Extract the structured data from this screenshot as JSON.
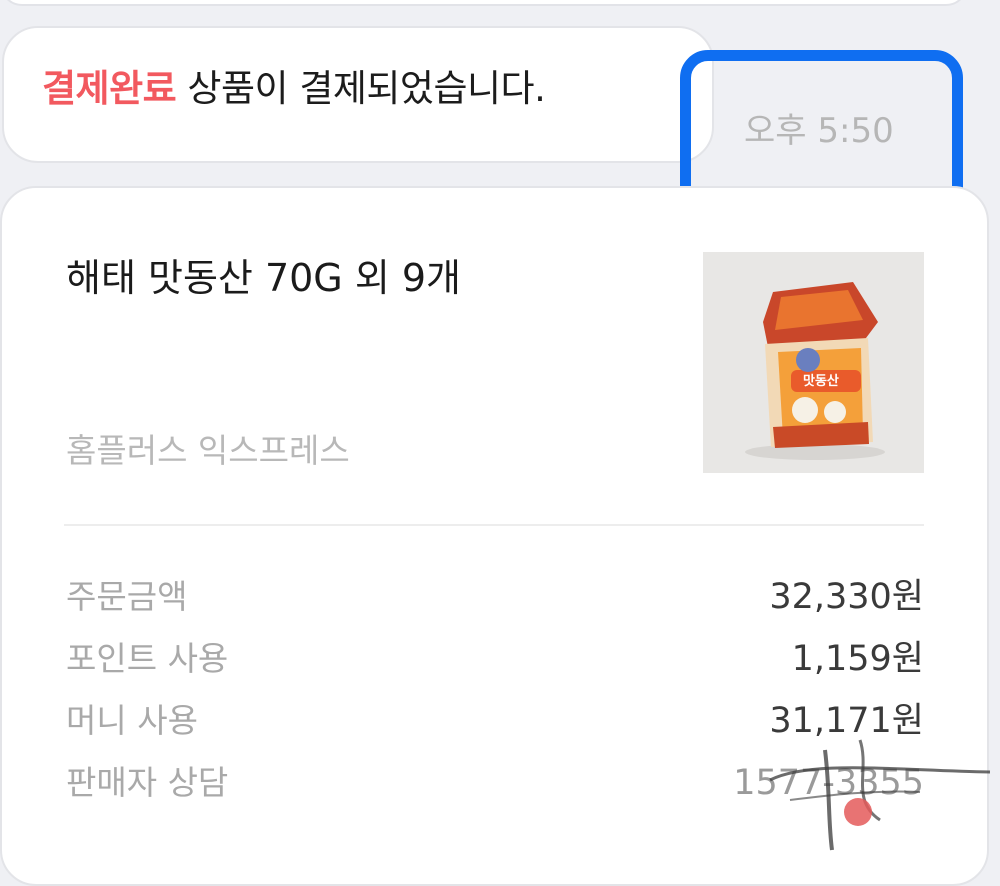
{
  "message": {
    "status_label": "결제완료",
    "text": " 상품이 결제되었습니다.",
    "time": "오후 5:50"
  },
  "order": {
    "product_title": "해태 맛동산 70G 외 9개",
    "store_name": "홈플러스 익스프레스",
    "thumbnail_label": "맛동산",
    "rows": [
      {
        "label": "주문금액",
        "value": "32,330원"
      },
      {
        "label": "포인트 사용",
        "value": "1,159원"
      },
      {
        "label": "머니 사용",
        "value": "31,171원"
      },
      {
        "label": "판매자 상담",
        "value": "1577-3355"
      }
    ]
  },
  "colors": {
    "status_red": "#f2595f",
    "highlight_blue": "#0f6ef1",
    "background": "#eff0f4"
  }
}
